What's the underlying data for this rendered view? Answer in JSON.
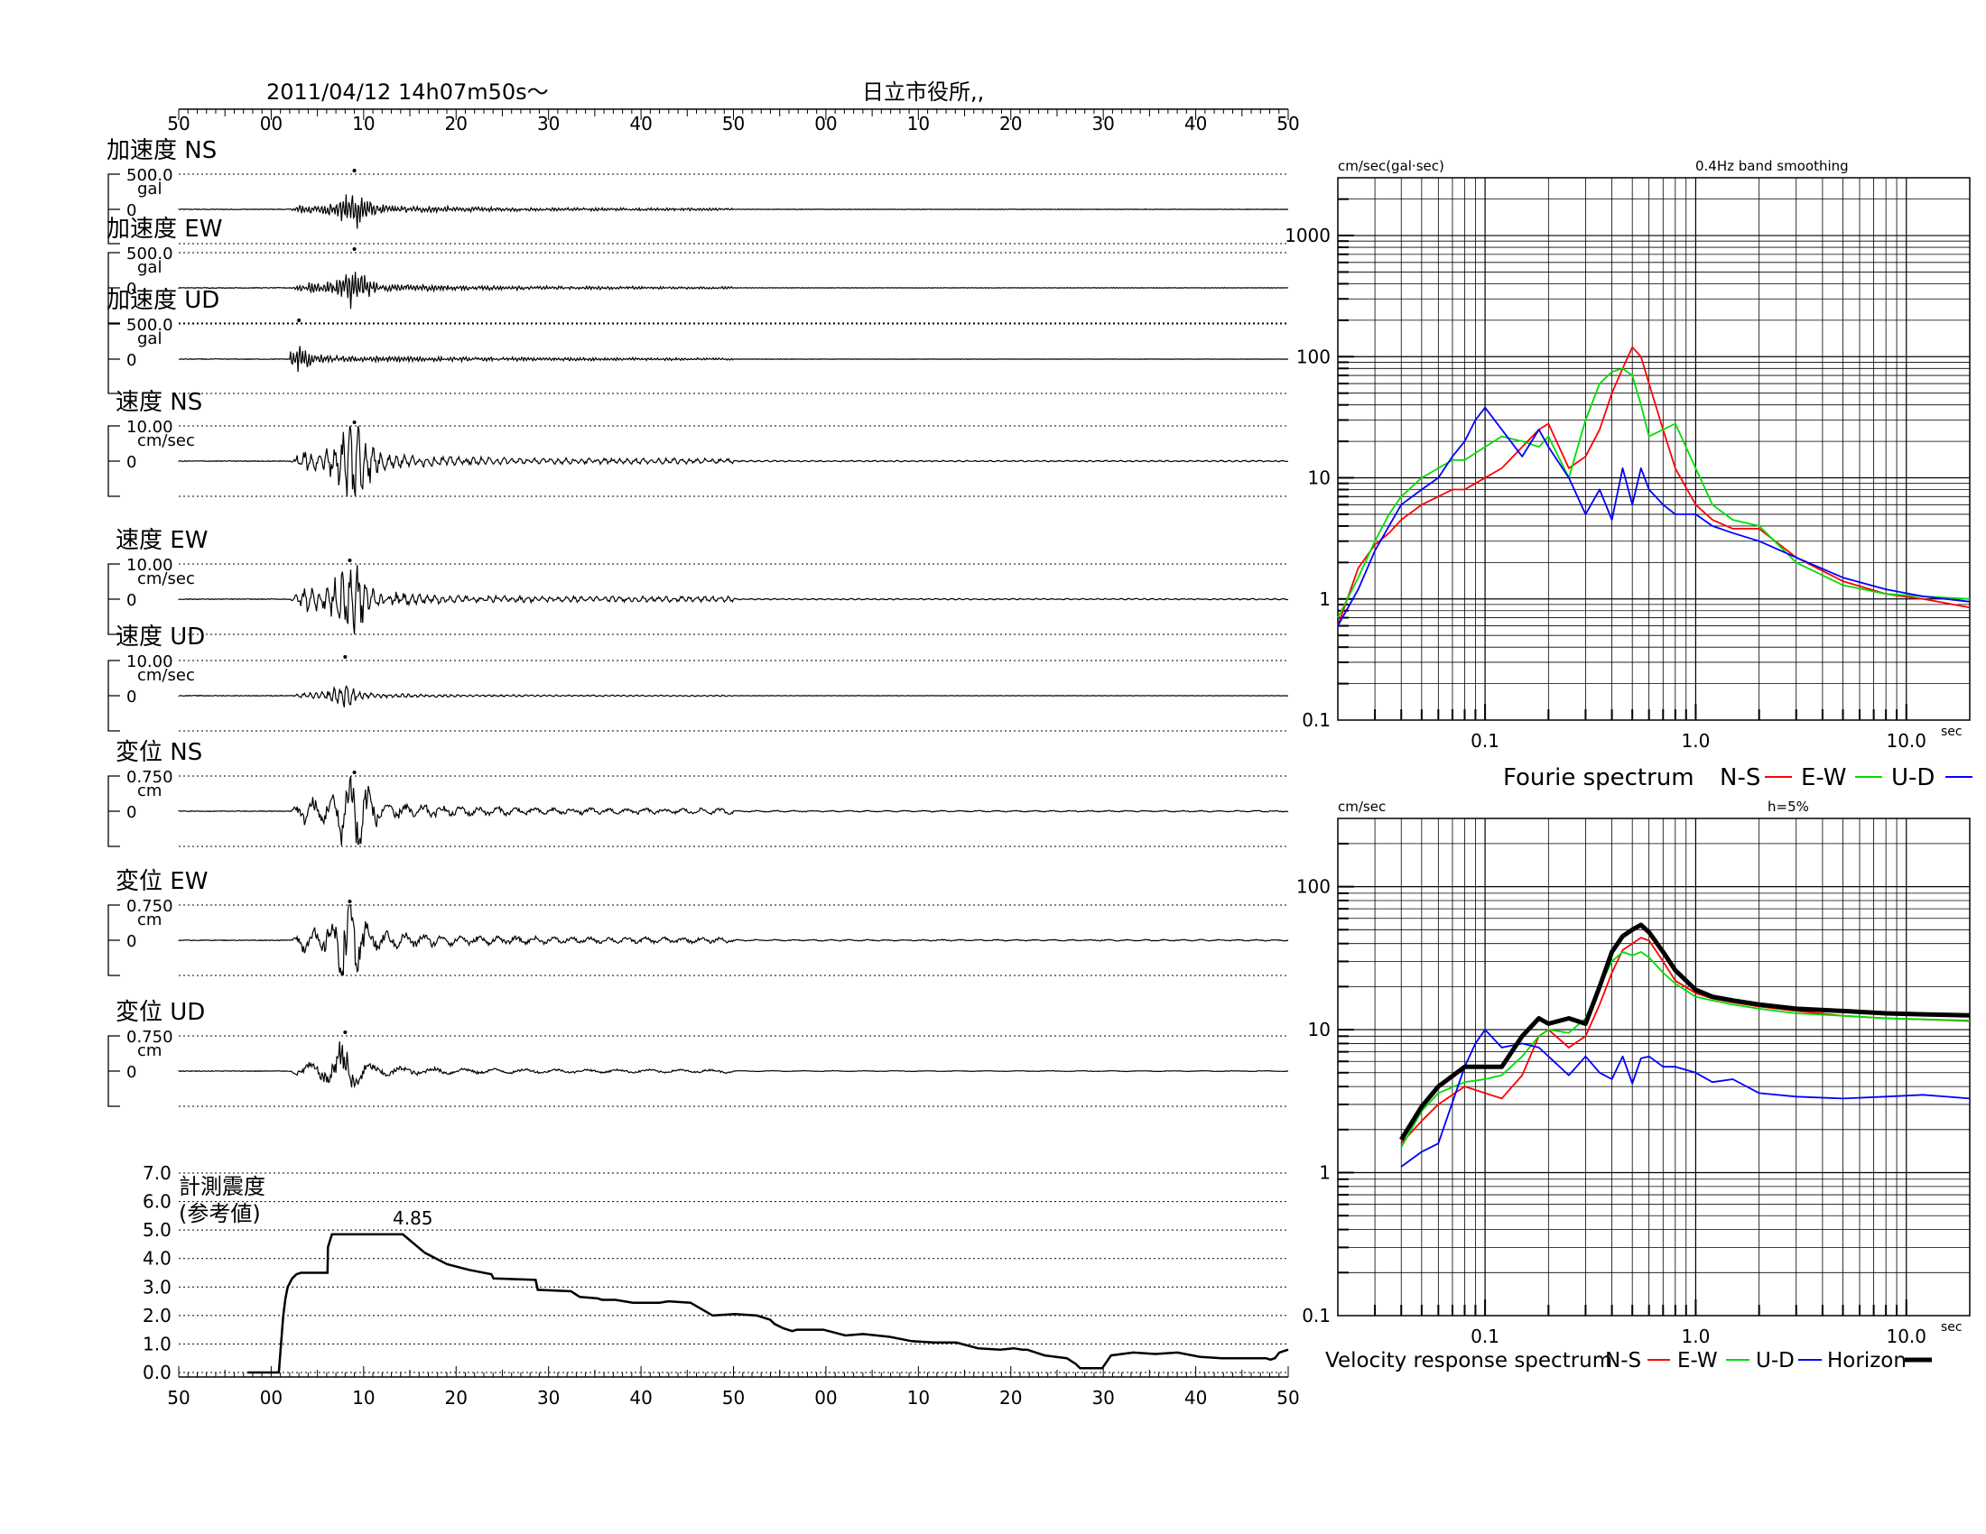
{
  "header": {
    "datetime": "2011/04/12  14h07m50s〜",
    "station": "日立市役所,,"
  },
  "time_axis": {
    "labels": [
      "50",
      "00",
      "10",
      "20",
      "30",
      "40",
      "50",
      "00",
      "10",
      "20",
      "30",
      "40",
      "50"
    ],
    "range_s": [
      0,
      120
    ]
  },
  "colors": {
    "ns": "#ff0000",
    "ew": "#00dd00",
    "ud": "#0000ff",
    "horizon": "#000000"
  },
  "chart_data": [
    {
      "type": "line",
      "title": "加速度 NS",
      "scale_label": "500.0",
      "unit": "gal",
      "zero_label": "0",
      "peak_time_s": 19,
      "series": [
        {
          "name": "加速度 NS"
        }
      ]
    },
    {
      "type": "line",
      "title": "加速度 EW",
      "scale_label": "500.0",
      "unit": "gal",
      "zero_label": "0",
      "peak_time_s": 19,
      "series": [
        {
          "name": "加速度 EW"
        }
      ]
    },
    {
      "type": "line",
      "title": "加速度 UD",
      "scale_label": "500.0",
      "unit": "gal",
      "zero_label": "0",
      "peak_time_s": 13,
      "series": [
        {
          "name": "加速度 UD"
        }
      ]
    },
    {
      "type": "line",
      "title": "速度 NS",
      "scale_label": "10.00",
      "unit": "cm/sec",
      "zero_label": "0",
      "peak_time_s": 19,
      "series": [
        {
          "name": "速度 NS"
        }
      ]
    },
    {
      "type": "line",
      "title": "速度 EW",
      "scale_label": "10.00",
      "unit": "cm/sec",
      "zero_label": "0",
      "peak_time_s": 18.5,
      "series": [
        {
          "name": "速度 EW"
        }
      ]
    },
    {
      "type": "line",
      "title": "速度 UD",
      "scale_label": "10.00",
      "unit": "cm/sec",
      "zero_label": "0",
      "peak_time_s": 18,
      "series": [
        {
          "name": "速度 UD"
        }
      ]
    },
    {
      "type": "line",
      "title": "変位 NS",
      "scale_label": "0.750",
      "unit": "cm",
      "zero_label": "0",
      "peak_time_s": 19,
      "series": [
        {
          "name": "変位 NS"
        }
      ]
    },
    {
      "type": "line",
      "title": "変位 EW",
      "scale_label": "0.750",
      "unit": "cm",
      "zero_label": "0",
      "peak_time_s": 18.5,
      "series": [
        {
          "name": "変位 EW"
        }
      ]
    },
    {
      "type": "line",
      "title": "変位 UD",
      "scale_label": "0.750",
      "unit": "cm",
      "zero_label": "0",
      "peak_time_s": 18,
      "series": [
        {
          "name": "変位 UD"
        }
      ]
    },
    {
      "type": "line",
      "title": "計測震度",
      "subtitle": "(参考値)",
      "ylim": [
        0,
        7
      ],
      "yticks": [
        "0.0",
        "1.0",
        "2.0",
        "3.0",
        "4.0",
        "5.0",
        "6.0",
        "7.0"
      ],
      "max_label": "4.85",
      "x": [
        5,
        12,
        12.5,
        13,
        13.5,
        14,
        15,
        16,
        17,
        18,
        18.1,
        23,
        23.1,
        24,
        25,
        26,
        26.1,
        40,
        45,
        50,
        55,
        60,
        60.5,
        70,
        70.5,
        78,
        80,
        84,
        85,
        88,
        90,
        92,
        94,
        96,
        98,
        100,
        105,
        110,
        115,
        120,
        123,
        124,
        126,
        128,
        129,
        130,
        135,
        140,
        144,
        150,
        155,
        160,
        165,
        170,
        175,
        178,
        180,
        181,
        182,
        183,
        185,
        190,
        192,
        193,
        198,
        200,
        205,
        210,
        215,
        220,
        225,
        230,
        233,
        234,
        235,
        236,
        237,
        238,
        240
      ],
      "values": [
        0,
        0,
        1,
        2,
        2.6,
        3.0,
        3.3,
        3.45,
        3.5,
        3.5,
        3.5,
        3.5,
        4.4,
        4.85,
        4.85,
        4.85,
        4.85,
        4.85,
        4.2,
        3.8,
        3.6,
        3.45,
        3.3,
        3.25,
        2.9,
        2.85,
        2.65,
        2.6,
        2.55,
        2.55,
        2.5,
        2.45,
        2.45,
        2.45,
        2.45,
        2.5,
        2.45,
        2.0,
        2.05,
        2.0,
        1.85,
        1.7,
        1.55,
        1.45,
        1.5,
        1.5,
        1.5,
        1.3,
        1.35,
        1.25,
        1.1,
        1.05,
        1.05,
        0.85,
        0.8,
        0.85,
        0.8,
        0.8,
        0.75,
        0.7,
        0.6,
        0.5,
        0.3,
        0.15,
        0.15,
        0.6,
        0.7,
        0.65,
        0.7,
        0.55,
        0.5,
        0.5,
        0.5,
        0.5,
        0.5,
        0.45,
        0.5,
        0.7,
        0.8
      ]
    },
    {
      "type": "line",
      "title": "Fourie spectrum",
      "yunit": "cm/sec(gal·sec)",
      "note": "0.4Hz band smoothing",
      "xunit": "sec",
      "scale": "log-log",
      "xlim": [
        0.02,
        20
      ],
      "ylim": [
        0.1,
        3000
      ],
      "yticks": [
        "0.1",
        "1",
        "10",
        "100",
        "1000"
      ],
      "xticks": [
        "0.1",
        "1.0",
        "10.0"
      ],
      "legend": [
        "N-S",
        "E-W",
        "U-D"
      ],
      "series": [
        {
          "name": "N-S",
          "x": [
            0.02,
            0.025,
            0.03,
            0.035,
            0.04,
            0.05,
            0.06,
            0.07,
            0.08,
            0.09,
            0.1,
            0.12,
            0.15,
            0.18,
            0.2,
            0.25,
            0.3,
            0.35,
            0.4,
            0.45,
            0.5,
            0.55,
            0.6,
            0.7,
            0.8,
            1.0,
            1.2,
            1.5,
            2,
            3,
            5,
            8,
            12,
            20
          ],
          "y": [
            0.6,
            1.8,
            2.8,
            3.5,
            4.5,
            6,
            7,
            8,
            8,
            9,
            10,
            12,
            18,
            25,
            28,
            12,
            15,
            25,
            50,
            80,
            120,
            100,
            60,
            25,
            12,
            6,
            4.5,
            3.8,
            3.8,
            2.2,
            1.4,
            1.1,
            1.0,
            0.85
          ]
        },
        {
          "name": "E-W",
          "x": [
            0.02,
            0.025,
            0.03,
            0.035,
            0.04,
            0.05,
            0.06,
            0.07,
            0.08,
            0.09,
            0.1,
            0.12,
            0.15,
            0.18,
            0.2,
            0.25,
            0.3,
            0.35,
            0.4,
            0.45,
            0.5,
            0.55,
            0.6,
            0.7,
            0.8,
            1.0,
            1.2,
            1.5,
            2,
            3,
            5,
            8,
            12,
            20
          ],
          "y": [
            0.7,
            1.5,
            3,
            5,
            7,
            10,
            12,
            14,
            14,
            16,
            18,
            22,
            20,
            18,
            22,
            10,
            30,
            60,
            75,
            80,
            70,
            40,
            22,
            25,
            28,
            12,
            6,
            4.5,
            4.0,
            2.0,
            1.3,
            1.1,
            1.05,
            1.0
          ]
        },
        {
          "name": "U-D",
          "x": [
            0.02,
            0.025,
            0.03,
            0.035,
            0.04,
            0.05,
            0.06,
            0.07,
            0.08,
            0.09,
            0.1,
            0.12,
            0.15,
            0.18,
            0.2,
            0.25,
            0.3,
            0.35,
            0.4,
            0.45,
            0.5,
            0.55,
            0.6,
            0.7,
            0.8,
            1.0,
            1.2,
            1.5,
            2,
            3,
            5,
            8,
            12,
            20
          ],
          "y": [
            0.6,
            1.2,
            2.5,
            4,
            6,
            8,
            10,
            15,
            20,
            30,
            38,
            25,
            15,
            25,
            18,
            10,
            5,
            8,
            4.5,
            12,
            6,
            12,
            8,
            6,
            5,
            5,
            4,
            3.5,
            3.0,
            2.2,
            1.5,
            1.2,
            1.05,
            0.95
          ]
        }
      ]
    },
    {
      "type": "line",
      "title": "Velocity response spectrum",
      "yunit": "cm/sec",
      "note": "h=5%",
      "xunit": "sec",
      "scale": "log-log",
      "xlim": [
        0.02,
        20
      ],
      "ylim": [
        0.1,
        300
      ],
      "yticks": [
        "0.1",
        "1",
        "10",
        "100"
      ],
      "xticks": [
        "0.1",
        "1.0",
        "10.0"
      ],
      "legend": [
        "N-S",
        "E-W",
        "U-D",
        "Horizon"
      ],
      "series": [
        {
          "name": "N-S",
          "x": [
            0.04,
            0.05,
            0.06,
            0.08,
            0.1,
            0.12,
            0.15,
            0.18,
            0.2,
            0.25,
            0.3,
            0.35,
            0.4,
            0.45,
            0.5,
            0.55,
            0.6,
            0.7,
            0.8,
            1.0,
            1.2,
            1.5,
            2,
            3,
            5,
            8,
            12,
            20
          ],
          "y": [
            1.6,
            2.3,
            3.0,
            4.0,
            3.6,
            3.3,
            4.8,
            9.0,
            10,
            7.5,
            9,
            15,
            25,
            36,
            40,
            44,
            42,
            30,
            22,
            18,
            16.5,
            15.5,
            14.5,
            13.5,
            12.5,
            12,
            11.8,
            11.5
          ]
        },
        {
          "name": "E-W",
          "x": [
            0.04,
            0.05,
            0.06,
            0.08,
            0.1,
            0.12,
            0.15,
            0.18,
            0.2,
            0.25,
            0.3,
            0.35,
            0.4,
            0.45,
            0.5,
            0.55,
            0.6,
            0.7,
            0.8,
            1.0,
            1.2,
            1.5,
            2,
            3,
            5,
            8,
            12,
            20
          ],
          "y": [
            1.5,
            2.7,
            3.6,
            4.3,
            4.5,
            4.8,
            6.5,
            9,
            10,
            9.5,
            12,
            20,
            30,
            35,
            33,
            35,
            32,
            25,
            21,
            17,
            16,
            15,
            14,
            13,
            12.5,
            12,
            11.8,
            11.6
          ]
        },
        {
          "name": "U-D",
          "x": [
            0.04,
            0.05,
            0.06,
            0.08,
            0.09,
            0.1,
            0.12,
            0.15,
            0.18,
            0.2,
            0.25,
            0.3,
            0.35,
            0.4,
            0.45,
            0.5,
            0.55,
            0.6,
            0.7,
            0.8,
            1.0,
            1.2,
            1.5,
            2,
            3,
            5,
            8,
            12,
            20
          ],
          "y": [
            1.1,
            1.4,
            1.6,
            5.5,
            8,
            10,
            7.5,
            8.0,
            7.5,
            6.5,
            4.8,
            6.5,
            5.0,
            4.5,
            6.5,
            4.2,
            6.3,
            6.5,
            5.5,
            5.5,
            5.0,
            4.3,
            4.5,
            3.6,
            3.4,
            3.3,
            3.4,
            3.5,
            3.3
          ]
        },
        {
          "name": "Horizon",
          "x": [
            0.04,
            0.05,
            0.06,
            0.08,
            0.1,
            0.12,
            0.15,
            0.18,
            0.2,
            0.25,
            0.3,
            0.35,
            0.4,
            0.45,
            0.5,
            0.55,
            0.6,
            0.7,
            0.8,
            1.0,
            1.2,
            1.5,
            2,
            3,
            5,
            8,
            12,
            20
          ],
          "y": [
            1.7,
            2.9,
            4.0,
            5.5,
            5.5,
            5.5,
            9,
            12,
            11,
            12,
            11,
            20,
            35,
            45,
            50,
            54,
            48,
            35,
            26,
            19,
            17,
            16,
            15,
            14,
            13.5,
            13,
            12.8,
            12.6
          ]
        }
      ]
    }
  ]
}
